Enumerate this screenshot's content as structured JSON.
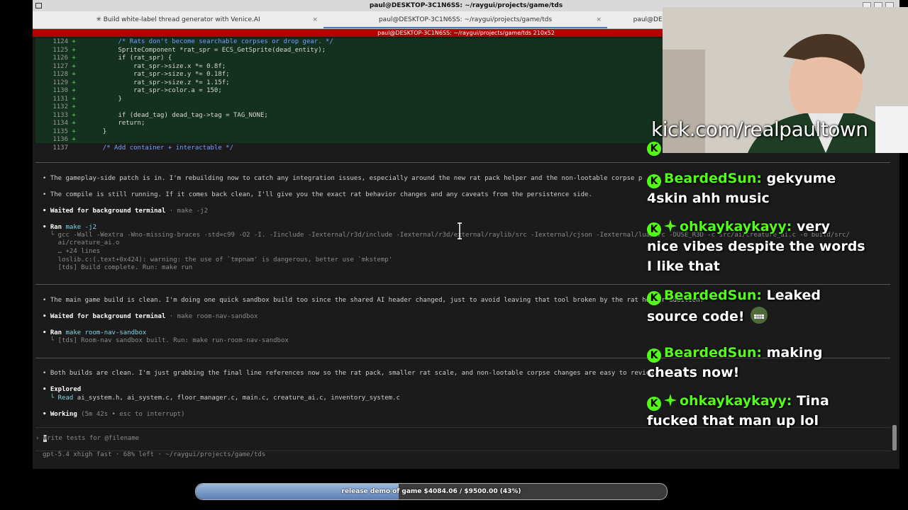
{
  "window": {
    "title": "paul@DESKTOP-3C1N6SS: ~/raygui/projects/game/tds",
    "tabs": [
      {
        "label": "✳ Build white-label thread generator with Venice.AI",
        "active": false
      },
      {
        "label": "paul@DESKTOP-3C1N6SS: ~/raygui/projects/game/tds",
        "active": true
      },
      {
        "label": "paul@DES",
        "active": false
      }
    ],
    "pane_title": "paul@DESKTOP-3C1N6SS: ~/raygui/projects/game/tds 210x52",
    "close_glyph": "×"
  },
  "diff_lines": [
    {
      "num": "1124",
      "sign": "+",
      "code": "        /* Rats don't become searchable corpses or drop gear. */",
      "style": "cm"
    },
    {
      "num": "1125",
      "sign": "+",
      "code": "        SpriteComponent *rat_spr = ECS_GetSprite(dead_entity);",
      "style": ""
    },
    {
      "num": "1126",
      "sign": "+",
      "code": "        if (rat_spr) {",
      "style": ""
    },
    {
      "num": "1127",
      "sign": "+",
      "code": "            rat_spr->size.x *= 0.8f;",
      "style": ""
    },
    {
      "num": "1128",
      "sign": "+",
      "code": "            rat_spr->size.y *= 0.18f;",
      "style": ""
    },
    {
      "num": "1129",
      "sign": "+",
      "code": "            rat_spr->size.z *= 1.15f;",
      "style": ""
    },
    {
      "num": "1130",
      "sign": "+",
      "code": "            rat_spr->color.a = 150;",
      "style": ""
    },
    {
      "num": "1131",
      "sign": "+",
      "code": "        }",
      "style": ""
    },
    {
      "num": "1132",
      "sign": "+",
      "code": "",
      "style": ""
    },
    {
      "num": "1133",
      "sign": "+",
      "code": "        if (dead_tag) dead_tag->tag = TAG_NONE;",
      "style": ""
    },
    {
      "num": "1134",
      "sign": "+",
      "code": "        return;",
      "style": ""
    },
    {
      "num": "1135",
      "sign": "+",
      "code": "    }",
      "style": ""
    },
    {
      "num": "1136",
      "sign": "+",
      "code": "",
      "style": ""
    },
    {
      "num": "1137",
      "sign": " ",
      "code": "    /* Add container + interactable */",
      "style": "cm"
    }
  ],
  "log": {
    "msg1": "• The gameplay-side patch is in. I'm rebuilding now to catch any integration issues, especially around the new rat pack helper and the non-lootable corpse p",
    "msg2": "• The compile is still running. If it comes back clean, I'll give you the exact rat behavior changes and any caveats from the persistence side.",
    "wait1_label": "• Waited for background terminal",
    "wait1_cmd": " · make -j2",
    "ran1_label": "• Ran",
    "ran1_cmd": " make -j2",
    "ran1_out1": "  └ gcc -Wall -Wextra -Wno-missing-braces -std=c99 -O2 -I. -Iinclude -Iexternal/r3d/include -Iexternal/r3d/external/raylib/src -Iexternal/cjson -Iexternal/lua/src -DUSE_R3D -c src/ai/creature_ai.c -o build/src/",
    "ran1_out2": "    ai/creature_ai.o",
    "ran1_out3": "    … +24 lines",
    "ran1_out4": "    loslib.c:(.text+0x424): warning: the use of `tmpnam' is dangerous, better use `mkstemp'",
    "ran1_out5": "    [tds] Build complete. Run: make run",
    "msg3": "• The main game build is clean. I'm doing one quick sandbox build too since the shared AI header changed, just to avoid leaving that tool broken by the rat helper addition.",
    "wait2_label": "• Waited for background terminal",
    "wait2_cmd": " · make room-nav-sandbox",
    "ran2_label": "• Ran",
    "ran2_cmd": " make room-nav-sandbox",
    "ran2_out1": "  └ [tds] Room-nav sandbox built. Run: make run-room-nav-sandbox",
    "msg4": "• Both builds are clean. I'm just grabbing the final line references now so the rat pack, smaller rat scale, and non-lootable corpse changes are easy to review.",
    "explored_label": "• Explored",
    "explored_read": "  └ Read",
    "explored_files": " ai_system.h, ai_system.c, floor_manager.c, main.c, creature_ai.c, inventory_system.c",
    "working_label": "• Working",
    "working_status": " (5m 42s • esc to interrupt)"
  },
  "prompt": {
    "marker": "›",
    "placeholder": "rite tests for @filename",
    "first_char": "W"
  },
  "status_line": "gpt-5.4 xhigh fast · 68% left · ~/raygui/projects/game/tds",
  "stream": {
    "kick_url": "kick.com/realpaultown",
    "chat": [
      {
        "user": "BeardedSun:",
        "text": " gekyume",
        "line2": "4skin ahh music",
        "line3": "",
        "badge2": false
      },
      {
        "user": "ohkaykaykayy:",
        "text": " very",
        "line2": "nice vibes despite the words",
        "line3": "I like that",
        "badge2": true
      },
      {
        "user": "BeardedSun:",
        "text": " Leaked",
        "line2": "source code!",
        "line3": "",
        "badge2": false
      },
      {
        "user": "BeardedSun:",
        "text": " making",
        "line2": "cheats now!",
        "line3": "",
        "badge2": false
      },
      {
        "user": "ohkaykaykayy:",
        "text": " Tina",
        "line2": "fucked that man up lol",
        "line3": "",
        "badge2": true
      }
    ],
    "goal_label": "release demo of game $4084.06 / $9500.00 (43%)",
    "goal_progress": 0.43,
    "kick_badge": "K"
  },
  "colors": {
    "kick_green": "#53fc18",
    "pane_red": "#b00000",
    "diff_bg": "#14301e"
  }
}
